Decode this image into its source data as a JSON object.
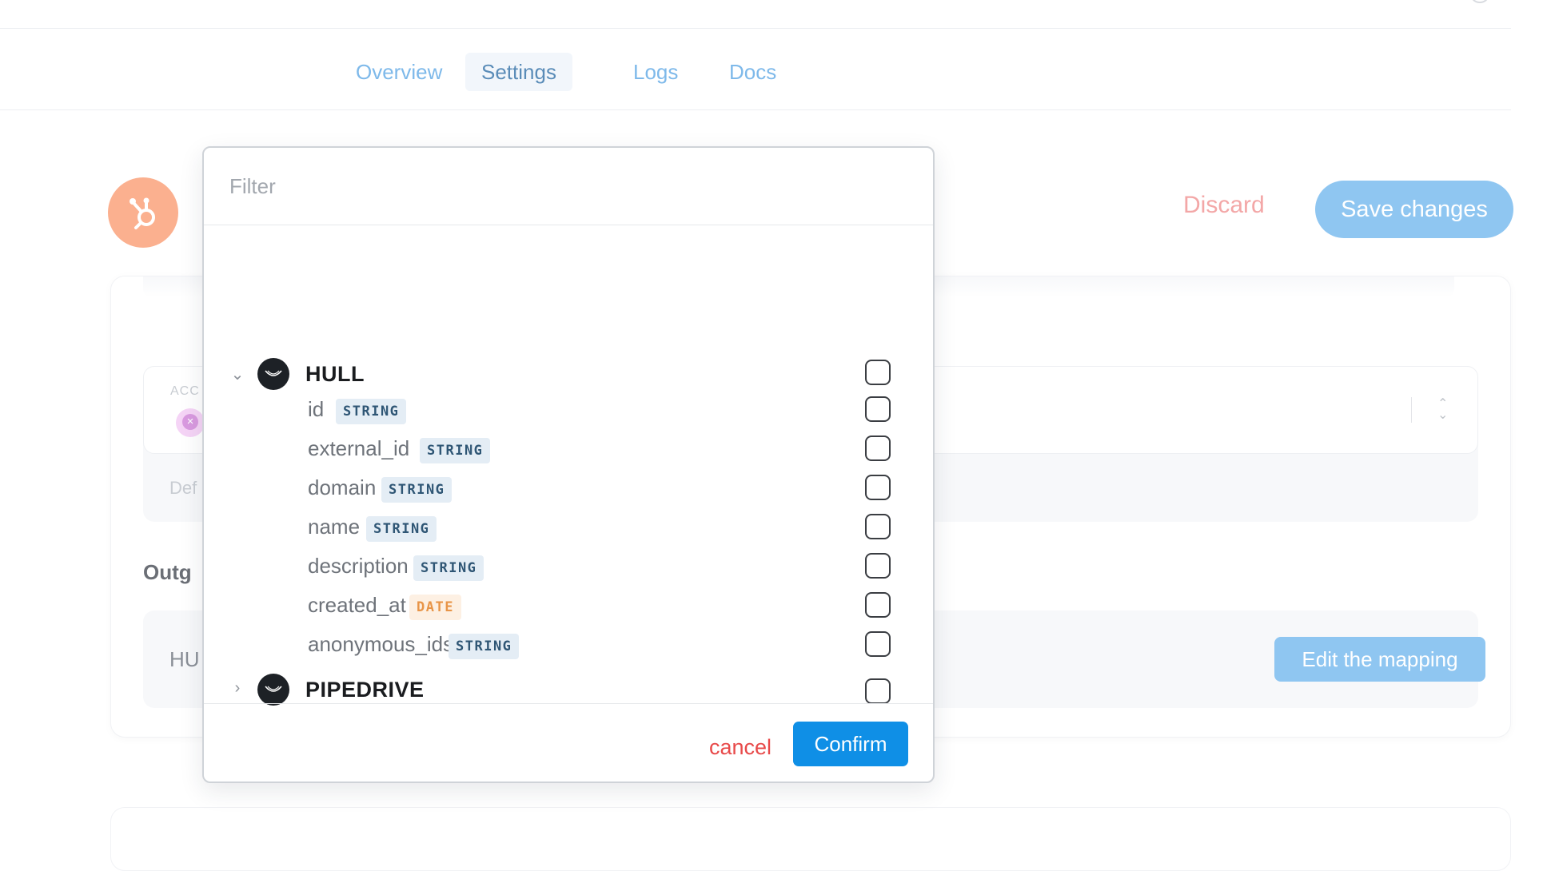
{
  "tabs": [
    {
      "label": "Overview",
      "active": false
    },
    {
      "label": "Settings",
      "active": true
    },
    {
      "label": "Logs",
      "active": false
    },
    {
      "label": "Docs",
      "active": false
    }
  ],
  "header": {
    "discard_label": "Discard",
    "save_label": "Save changes"
  },
  "background": {
    "account_label": "ACC",
    "default_text": "Def",
    "outgoing_heading": "Outg",
    "row_label": "HU",
    "edit_mapping_label": "Edit the mapping"
  },
  "dropdown": {
    "filter_placeholder": "Filter",
    "groups": [
      {
        "label": "HULL",
        "expanded": true,
        "fields": [
          {
            "name": "id",
            "type": "STRING"
          },
          {
            "name": "external_id",
            "type": "STRING"
          },
          {
            "name": "domain",
            "type": "STRING"
          },
          {
            "name": "name",
            "type": "STRING"
          },
          {
            "name": "description",
            "type": "STRING"
          },
          {
            "name": "created_at",
            "type": "DATE"
          },
          {
            "name": "anonymous_ids",
            "type": "STRING"
          }
        ]
      },
      {
        "label": "PIPEDRIVE",
        "expanded": false,
        "fields": []
      }
    ],
    "cancel_label": "cancel",
    "confirm_label": "Confirm"
  },
  "colors": {
    "accent": "#0f8fe6",
    "save_button": "#8fc6f1",
    "discard": "#f3a7a7",
    "cancel": "#e84a4a",
    "logo_bg": "#fbb08f"
  },
  "icons": {
    "logo": "hubspot-icon",
    "group": "hull-logo-icon",
    "expanded": "chevron-down-icon",
    "collapsed": "chevron-right-icon"
  }
}
